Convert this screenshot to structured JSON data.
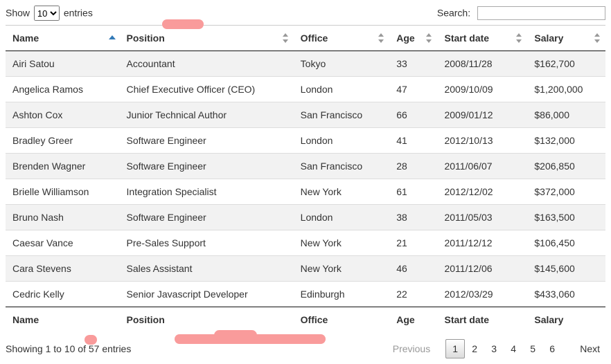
{
  "length": {
    "show": "Show",
    "value": "10",
    "entries": "entries"
  },
  "search": {
    "label": "Search:",
    "value": ""
  },
  "columns": {
    "name": "Name",
    "position": "Position",
    "office": "Office",
    "age": "Age",
    "start_date": "Start date",
    "salary": "Salary"
  },
  "rows": [
    {
      "name": "Airi Satou",
      "position": "Accountant",
      "office": "Tokyo",
      "age": "33",
      "start": "2008/11/28",
      "salary": "$162,700"
    },
    {
      "name": "Angelica Ramos",
      "position": "Chief Executive Officer (CEO)",
      "office": "London",
      "age": "47",
      "start": "2009/10/09",
      "salary": "$1,200,000"
    },
    {
      "name": "Ashton Cox",
      "position": "Junior Technical Author",
      "office": "San Francisco",
      "age": "66",
      "start": "2009/01/12",
      "salary": "$86,000"
    },
    {
      "name": "Bradley Greer",
      "position": "Software Engineer",
      "office": "London",
      "age": "41",
      "start": "2012/10/13",
      "salary": "$132,000"
    },
    {
      "name": "Brenden Wagner",
      "position": "Software Engineer",
      "office": "San Francisco",
      "age": "28",
      "start": "2011/06/07",
      "salary": "$206,850"
    },
    {
      "name": "Brielle Williamson",
      "position": "Integration Specialist",
      "office": "New York",
      "age": "61",
      "start": "2012/12/02",
      "salary": "$372,000"
    },
    {
      "name": "Bruno Nash",
      "position": "Software Engineer",
      "office": "London",
      "age": "38",
      "start": "2011/05/03",
      "salary": "$163,500"
    },
    {
      "name": "Caesar Vance",
      "position": "Pre-Sales Support",
      "office": "New York",
      "age": "21",
      "start": "2011/12/12",
      "salary": "$106,450"
    },
    {
      "name": "Cara Stevens",
      "position": "Sales Assistant",
      "office": "New York",
      "age": "46",
      "start": "2011/12/06",
      "salary": "$145,600"
    },
    {
      "name": "Cedric Kelly",
      "position": "Senior Javascript Developer",
      "office": "Edinburgh",
      "age": "22",
      "start": "2012/03/29",
      "salary": "$433,060"
    }
  ],
  "info": "Showing 1 to 10 of 57 entries",
  "paginate": {
    "previous": "Previous",
    "pages": [
      "1",
      "2",
      "3",
      "4",
      "5",
      "6"
    ],
    "current": "1",
    "next": "Next"
  }
}
